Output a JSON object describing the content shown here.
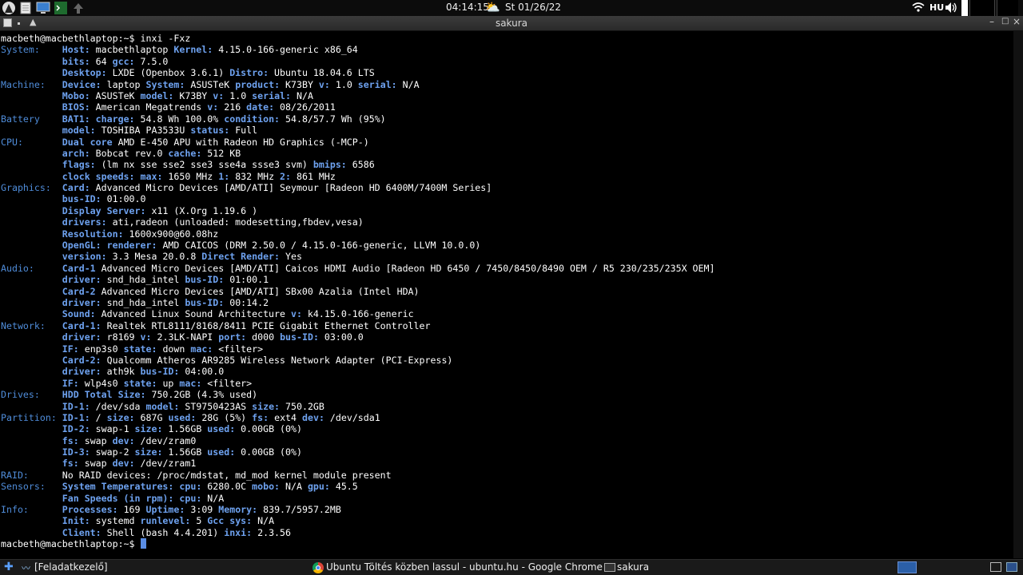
{
  "top_panel": {
    "time": "04:14:15",
    "weather_icon": "sun-cloud-icon",
    "date": "St 01/26/22",
    "keyboard_layout": "HU"
  },
  "window": {
    "title": "sakura",
    "buttons": {
      "minimize": "–",
      "maximize": "□",
      "close": "×"
    }
  },
  "terminal": {
    "lines": [
      [
        [
          "t",
          "macbeth@macbethlaptop:~$ inxi -Fxz"
        ]
      ],
      [
        [
          "lb",
          "System:    "
        ],
        [
          "k",
          "Host:"
        ],
        [
          "t",
          " macbethlaptop "
        ],
        [
          "k",
          "Kernel:"
        ],
        [
          "t",
          " 4.15.0-166-generic x86_64"
        ]
      ],
      [
        [
          "t",
          "           "
        ],
        [
          "k",
          "bits:"
        ],
        [
          "t",
          " 64 "
        ],
        [
          "k",
          "gcc:"
        ],
        [
          "t",
          " 7.5.0"
        ]
      ],
      [
        [
          "t",
          "           "
        ],
        [
          "k",
          "Desktop:"
        ],
        [
          "t",
          " LXDE (Openbox 3.6.1) "
        ],
        [
          "k",
          "Distro:"
        ],
        [
          "t",
          " Ubuntu 18.04.6 LTS"
        ]
      ],
      [
        [
          "lb",
          "Machine:   "
        ],
        [
          "k",
          "Device:"
        ],
        [
          "t",
          " laptop "
        ],
        [
          "k",
          "System:"
        ],
        [
          "t",
          " ASUSTeK "
        ],
        [
          "k",
          "product:"
        ],
        [
          "t",
          " K73BY "
        ],
        [
          "k",
          "v:"
        ],
        [
          "t",
          " 1.0 "
        ],
        [
          "k",
          "serial:"
        ],
        [
          "t",
          " N/A"
        ]
      ],
      [
        [
          "t",
          "           "
        ],
        [
          "k",
          "Mobo:"
        ],
        [
          "t",
          " ASUSTeK "
        ],
        [
          "k",
          "model:"
        ],
        [
          "t",
          " K73BY "
        ],
        [
          "k",
          "v:"
        ],
        [
          "t",
          " 1.0 "
        ],
        [
          "k",
          "serial:"
        ],
        [
          "t",
          " N/A"
        ]
      ],
      [
        [
          "t",
          "           "
        ],
        [
          "k",
          "BIOS:"
        ],
        [
          "t",
          " American Megatrends "
        ],
        [
          "k",
          "v:"
        ],
        [
          "t",
          " 216 "
        ],
        [
          "k",
          "date:"
        ],
        [
          "t",
          " 08/26/2011"
        ]
      ],
      [
        [
          "lb",
          "Battery    "
        ],
        [
          "k",
          "BAT1:"
        ],
        [
          "t",
          " "
        ],
        [
          "k",
          "charge:"
        ],
        [
          "t",
          " 54.8 Wh 100.0% "
        ],
        [
          "k",
          "condition:"
        ],
        [
          "t",
          " 54.8/57.7 Wh (95%)"
        ]
      ],
      [
        [
          "t",
          "           "
        ],
        [
          "k",
          "model:"
        ],
        [
          "t",
          " TOSHIBA PA3533U "
        ],
        [
          "k",
          "status:"
        ],
        [
          "t",
          " Full"
        ]
      ],
      [
        [
          "lb",
          "CPU:       "
        ],
        [
          "k",
          "Dual core"
        ],
        [
          "t",
          " AMD E-450 APU with Radeon HD Graphics (-MCP-)"
        ]
      ],
      [
        [
          "t",
          "           "
        ],
        [
          "k",
          "arch:"
        ],
        [
          "t",
          " Bobcat rev.0 "
        ],
        [
          "k",
          "cache:"
        ],
        [
          "t",
          " 512 KB"
        ]
      ],
      [
        [
          "t",
          "           "
        ],
        [
          "k",
          "flags:"
        ],
        [
          "t",
          " (lm nx sse sse2 sse3 sse4a ssse3 svm) "
        ],
        [
          "k",
          "bmips:"
        ],
        [
          "t",
          " 6586"
        ]
      ],
      [
        [
          "t",
          "           "
        ],
        [
          "k",
          "clock speeds:"
        ],
        [
          "t",
          " "
        ],
        [
          "k",
          "max:"
        ],
        [
          "t",
          " 1650 MHz "
        ],
        [
          "k",
          "1:"
        ],
        [
          "t",
          " 832 MHz "
        ],
        [
          "k",
          "2:"
        ],
        [
          "t",
          " 861 MHz"
        ]
      ],
      [
        [
          "lb",
          "Graphics:  "
        ],
        [
          "k",
          "Card:"
        ],
        [
          "t",
          " Advanced Micro Devices [AMD/ATI] Seymour [Radeon HD 6400M/7400M Series]"
        ]
      ],
      [
        [
          "t",
          "           "
        ],
        [
          "k",
          "bus-ID:"
        ],
        [
          "t",
          " 01:00.0"
        ]
      ],
      [
        [
          "t",
          "           "
        ],
        [
          "k",
          "Display Server:"
        ],
        [
          "t",
          " x11 (X.Org 1.19.6 )"
        ]
      ],
      [
        [
          "t",
          "           "
        ],
        [
          "k",
          "drivers:"
        ],
        [
          "t",
          " ati,radeon (unloaded: modesetting,fbdev,vesa)"
        ]
      ],
      [
        [
          "t",
          "           "
        ],
        [
          "k",
          "Resolution:"
        ],
        [
          "t",
          " 1600x900@60.08hz"
        ]
      ],
      [
        [
          "t",
          "           "
        ],
        [
          "k",
          "OpenGL:"
        ],
        [
          "t",
          " "
        ],
        [
          "k",
          "renderer:"
        ],
        [
          "t",
          " AMD CAICOS (DRM 2.50.0 / 4.15.0-166-generic, LLVM 10.0.0)"
        ]
      ],
      [
        [
          "t",
          "           "
        ],
        [
          "k",
          "version:"
        ],
        [
          "t",
          " 3.3 Mesa 20.0.8 "
        ],
        [
          "k",
          "Direct Render:"
        ],
        [
          "t",
          " Yes"
        ]
      ],
      [
        [
          "lb",
          "Audio:     "
        ],
        [
          "k",
          "Card-1"
        ],
        [
          "t",
          " Advanced Micro Devices [AMD/ATI] Caicos HDMI Audio [Radeon HD 6450 / 7450/8450/8490 OEM / R5 230/235/235X OEM]"
        ]
      ],
      [
        [
          "t",
          "           "
        ],
        [
          "k",
          "driver:"
        ],
        [
          "t",
          " snd_hda_intel "
        ],
        [
          "k",
          "bus-ID:"
        ],
        [
          "t",
          " 01:00.1"
        ]
      ],
      [
        [
          "t",
          "           "
        ],
        [
          "k",
          "Card-2"
        ],
        [
          "t",
          " Advanced Micro Devices [AMD/ATI] SBx00 Azalia (Intel HDA)"
        ]
      ],
      [
        [
          "t",
          "           "
        ],
        [
          "k",
          "driver:"
        ],
        [
          "t",
          " snd_hda_intel "
        ],
        [
          "k",
          "bus-ID:"
        ],
        [
          "t",
          " 00:14.2"
        ]
      ],
      [
        [
          "t",
          "           "
        ],
        [
          "k",
          "Sound:"
        ],
        [
          "t",
          " Advanced Linux Sound Architecture "
        ],
        [
          "k",
          "v:"
        ],
        [
          "t",
          " k4.15.0-166-generic"
        ]
      ],
      [
        [
          "lb",
          "Network:   "
        ],
        [
          "k",
          "Card-1:"
        ],
        [
          "t",
          " Realtek RTL8111/8168/8411 PCIE Gigabit Ethernet Controller"
        ]
      ],
      [
        [
          "t",
          "           "
        ],
        [
          "k",
          "driver:"
        ],
        [
          "t",
          " r8169 "
        ],
        [
          "k",
          "v:"
        ],
        [
          "t",
          " 2.3LK-NAPI "
        ],
        [
          "k",
          "port:"
        ],
        [
          "t",
          " d000 "
        ],
        [
          "k",
          "bus-ID:"
        ],
        [
          "t",
          " 03:00.0"
        ]
      ],
      [
        [
          "t",
          "           "
        ],
        [
          "k",
          "IF:"
        ],
        [
          "t",
          " enp3s0 "
        ],
        [
          "k",
          "state:"
        ],
        [
          "t",
          " down "
        ],
        [
          "k",
          "mac:"
        ],
        [
          "t",
          " <filter>"
        ]
      ],
      [
        [
          "t",
          "           "
        ],
        [
          "k",
          "Card-2:"
        ],
        [
          "t",
          " Qualcomm Atheros AR9285 Wireless Network Adapter (PCI-Express)"
        ]
      ],
      [
        [
          "t",
          "           "
        ],
        [
          "k",
          "driver:"
        ],
        [
          "t",
          " ath9k "
        ],
        [
          "k",
          "bus-ID:"
        ],
        [
          "t",
          " 04:00.0"
        ]
      ],
      [
        [
          "t",
          "           "
        ],
        [
          "k",
          "IF:"
        ],
        [
          "t",
          " wlp4s0 "
        ],
        [
          "k",
          "state:"
        ],
        [
          "t",
          " up "
        ],
        [
          "k",
          "mac:"
        ],
        [
          "t",
          " <filter>"
        ]
      ],
      [
        [
          "lb",
          "Drives:    "
        ],
        [
          "k",
          "HDD Total Size:"
        ],
        [
          "t",
          " 750.2GB (4.3% used)"
        ]
      ],
      [
        [
          "t",
          "           "
        ],
        [
          "k",
          "ID-1:"
        ],
        [
          "t",
          " /dev/sda "
        ],
        [
          "k",
          "model:"
        ],
        [
          "t",
          " ST9750423AS "
        ],
        [
          "k",
          "size:"
        ],
        [
          "t",
          " 750.2GB"
        ]
      ],
      [
        [
          "lb",
          "Partition: "
        ],
        [
          "k",
          "ID-1:"
        ],
        [
          "t",
          " / "
        ],
        [
          "k",
          "size:"
        ],
        [
          "t",
          " 687G "
        ],
        [
          "k",
          "used:"
        ],
        [
          "t",
          " 28G (5%) "
        ],
        [
          "k",
          "fs:"
        ],
        [
          "t",
          " ext4 "
        ],
        [
          "k",
          "dev:"
        ],
        [
          "t",
          " /dev/sda1"
        ]
      ],
      [
        [
          "t",
          "           "
        ],
        [
          "k",
          "ID-2:"
        ],
        [
          "t",
          " swap-1 "
        ],
        [
          "k",
          "size:"
        ],
        [
          "t",
          " 1.56GB "
        ],
        [
          "k",
          "used:"
        ],
        [
          "t",
          " 0.00GB (0%)"
        ]
      ],
      [
        [
          "t",
          "           "
        ],
        [
          "k",
          "fs:"
        ],
        [
          "t",
          " swap "
        ],
        [
          "k",
          "dev:"
        ],
        [
          "t",
          " /dev/zram0"
        ]
      ],
      [
        [
          "t",
          "           "
        ],
        [
          "k",
          "ID-3:"
        ],
        [
          "t",
          " swap-2 "
        ],
        [
          "k",
          "size:"
        ],
        [
          "t",
          " 1.56GB "
        ],
        [
          "k",
          "used:"
        ],
        [
          "t",
          " 0.00GB (0%)"
        ]
      ],
      [
        [
          "t",
          "           "
        ],
        [
          "k",
          "fs:"
        ],
        [
          "t",
          " swap "
        ],
        [
          "k",
          "dev:"
        ],
        [
          "t",
          " /dev/zram1"
        ]
      ],
      [
        [
          "lb",
          "RAID:      "
        ],
        [
          "t",
          "No RAID devices: /proc/mdstat, md_mod kernel module present"
        ]
      ],
      [
        [
          "lb",
          "Sensors:   "
        ],
        [
          "k",
          "System Temperatures:"
        ],
        [
          "t",
          " "
        ],
        [
          "k",
          "cpu:"
        ],
        [
          "t",
          " 6280.0C "
        ],
        [
          "k",
          "mobo:"
        ],
        [
          "t",
          " N/A "
        ],
        [
          "k",
          "gpu:"
        ],
        [
          "t",
          " 45.5"
        ]
      ],
      [
        [
          "t",
          "           "
        ],
        [
          "k",
          "Fan Speeds (in rpm):"
        ],
        [
          "t",
          " "
        ],
        [
          "k",
          "cpu:"
        ],
        [
          "t",
          " N/A"
        ]
      ],
      [
        [
          "lb",
          "Info:      "
        ],
        [
          "k",
          "Processes:"
        ],
        [
          "t",
          " 169 "
        ],
        [
          "k",
          "Uptime:"
        ],
        [
          "t",
          " 3:09 "
        ],
        [
          "k",
          "Memory:"
        ],
        [
          "t",
          " 839.7/5957.2MB"
        ]
      ],
      [
        [
          "t",
          "           "
        ],
        [
          "k",
          "Init:"
        ],
        [
          "t",
          " systemd "
        ],
        [
          "k",
          "runlevel:"
        ],
        [
          "t",
          " 5 "
        ],
        [
          "k",
          "Gcc sys:"
        ],
        [
          "t",
          " N/A"
        ]
      ],
      [
        [
          "t",
          "           "
        ],
        [
          "k",
          "Client:"
        ],
        [
          "t",
          " Shell (bash 4.4.201) "
        ],
        [
          "k",
          "inxi:"
        ],
        [
          "t",
          " 2.3.56"
        ]
      ],
      [
        [
          "t",
          "macbeth@macbethlaptop:~$ "
        ]
      ]
    ]
  },
  "taskbar": {
    "task_manager_label": "[Feladatkezelő]",
    "chrome_label": "Ubuntu Töltés közben lassul - ubuntu.hu - Google Chrome",
    "sakura_label": "sakura"
  },
  "colors": {
    "label_blue": "#4f8cd9",
    "key_blue": "#6ea2f0",
    "cursor": "#5a8ee6"
  }
}
